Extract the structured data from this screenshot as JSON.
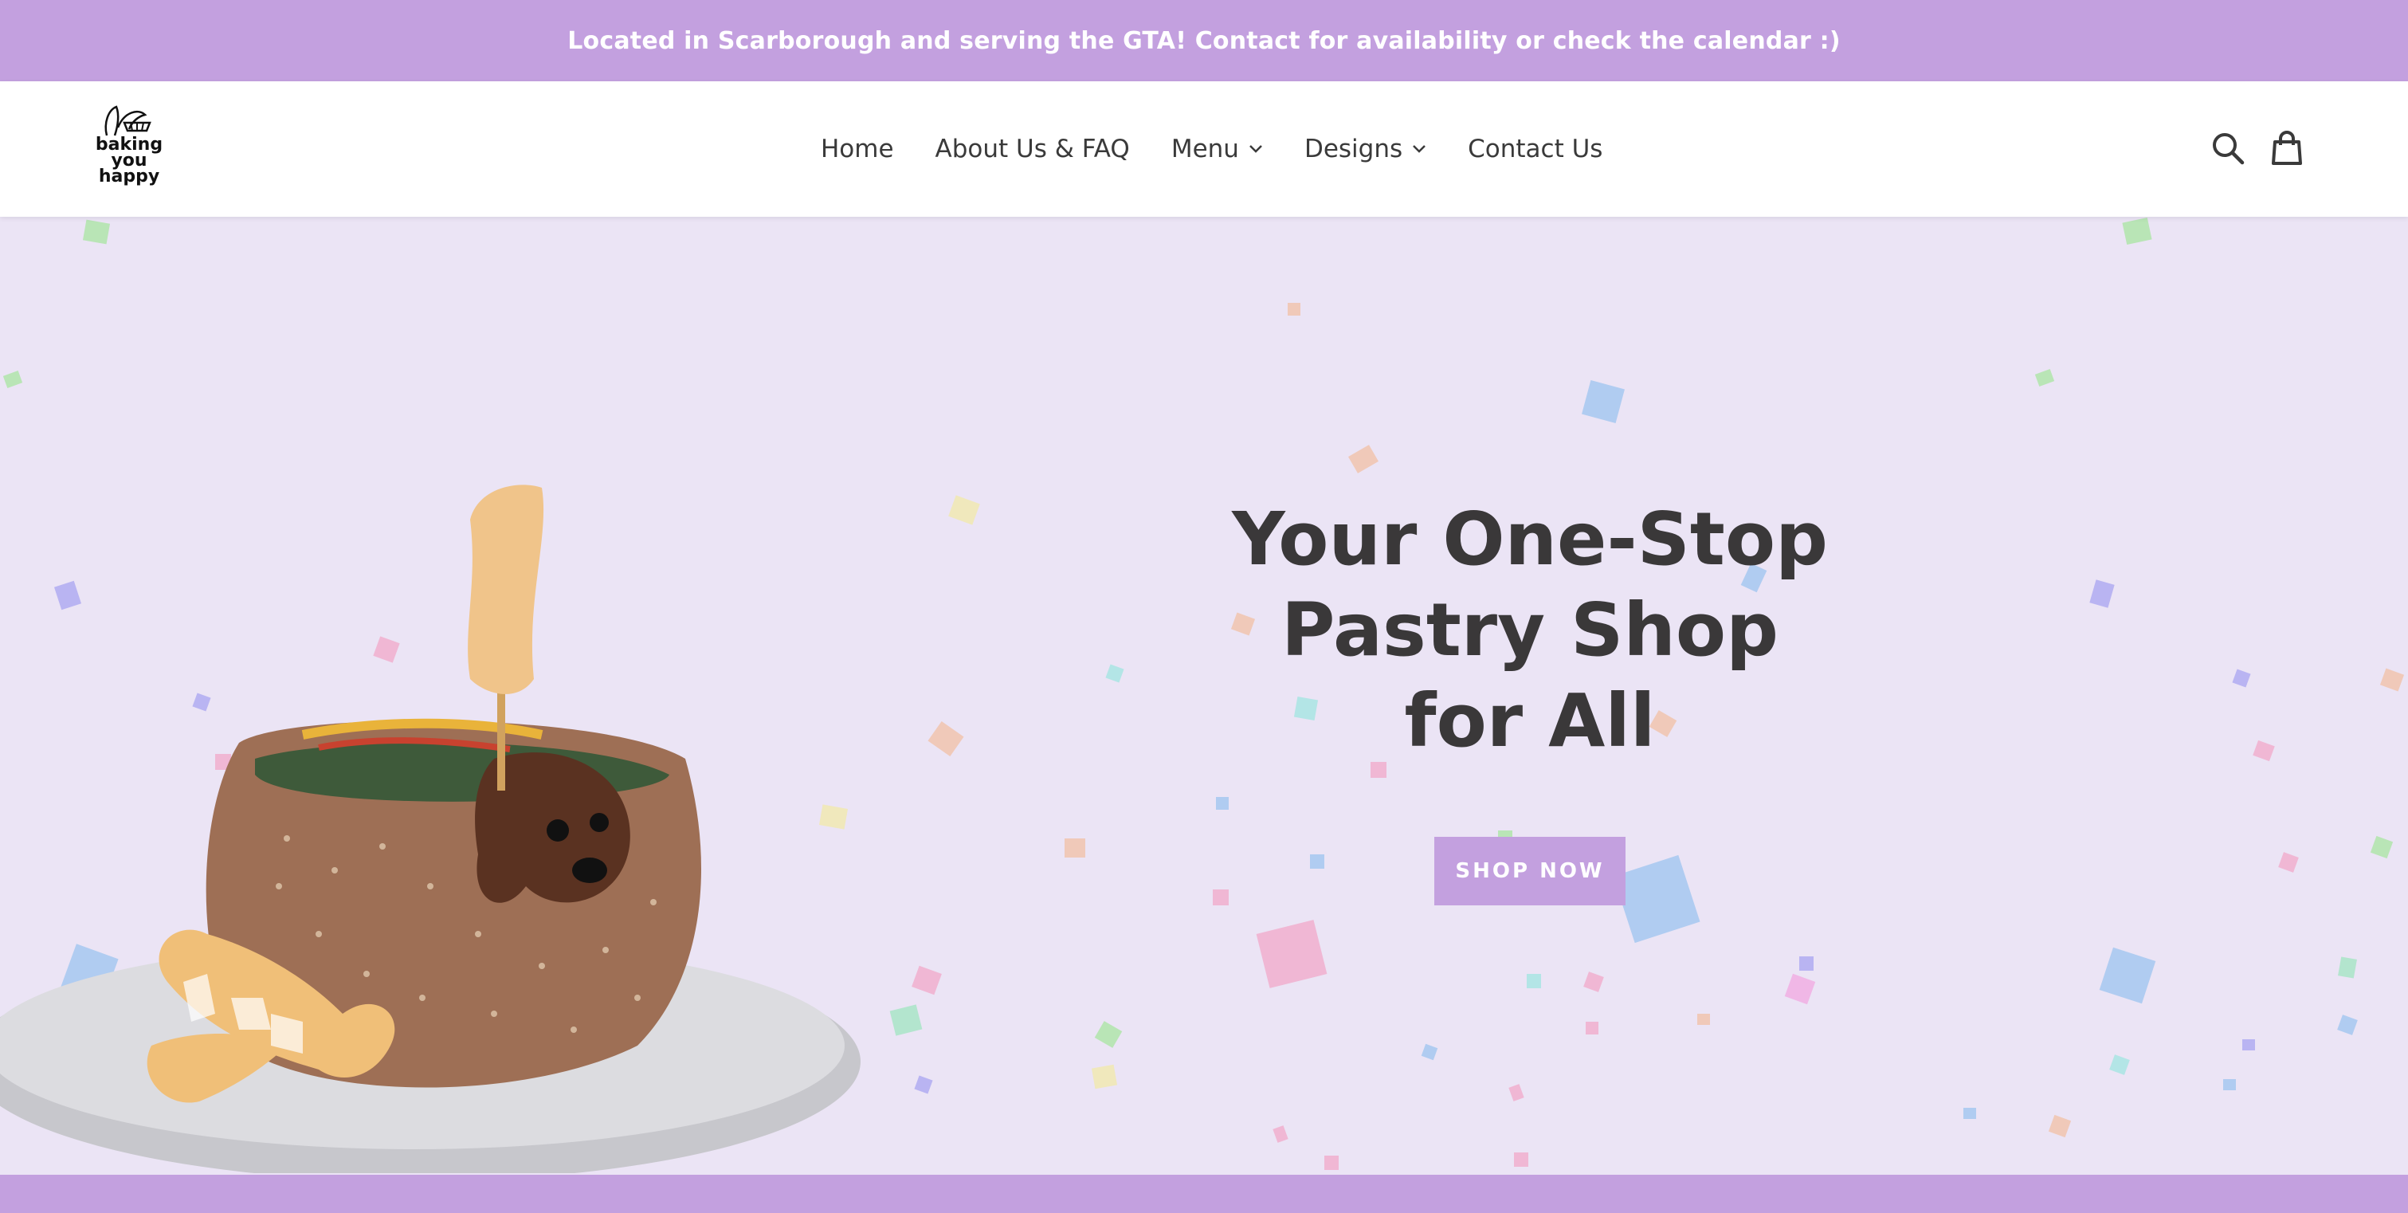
{
  "announcement": {
    "text": "Located in Scarborough and serving the GTA! Contact for availability or check the calendar :)"
  },
  "header": {
    "logo": {
      "line1": "baking",
      "line2": "you",
      "line3": "happy"
    },
    "nav": [
      {
        "label": "Home"
      },
      {
        "label": "About Us & FAQ"
      },
      {
        "label": "Menu"
      },
      {
        "label": "Designs"
      },
      {
        "label": "Contact Us"
      }
    ],
    "icons": [
      "search-icon",
      "cart-icon"
    ]
  },
  "hero": {
    "title_part1": "Your ",
    "title_highlight": "One-Stop",
    "title_line2": "Pastry Shop",
    "title_line3": "for All",
    "button_label": "SHOP NOW"
  },
  "colors": {
    "accent": "#c3a0df",
    "hero_bg": "#ebe4f5",
    "text_dark": "#3a3839"
  }
}
